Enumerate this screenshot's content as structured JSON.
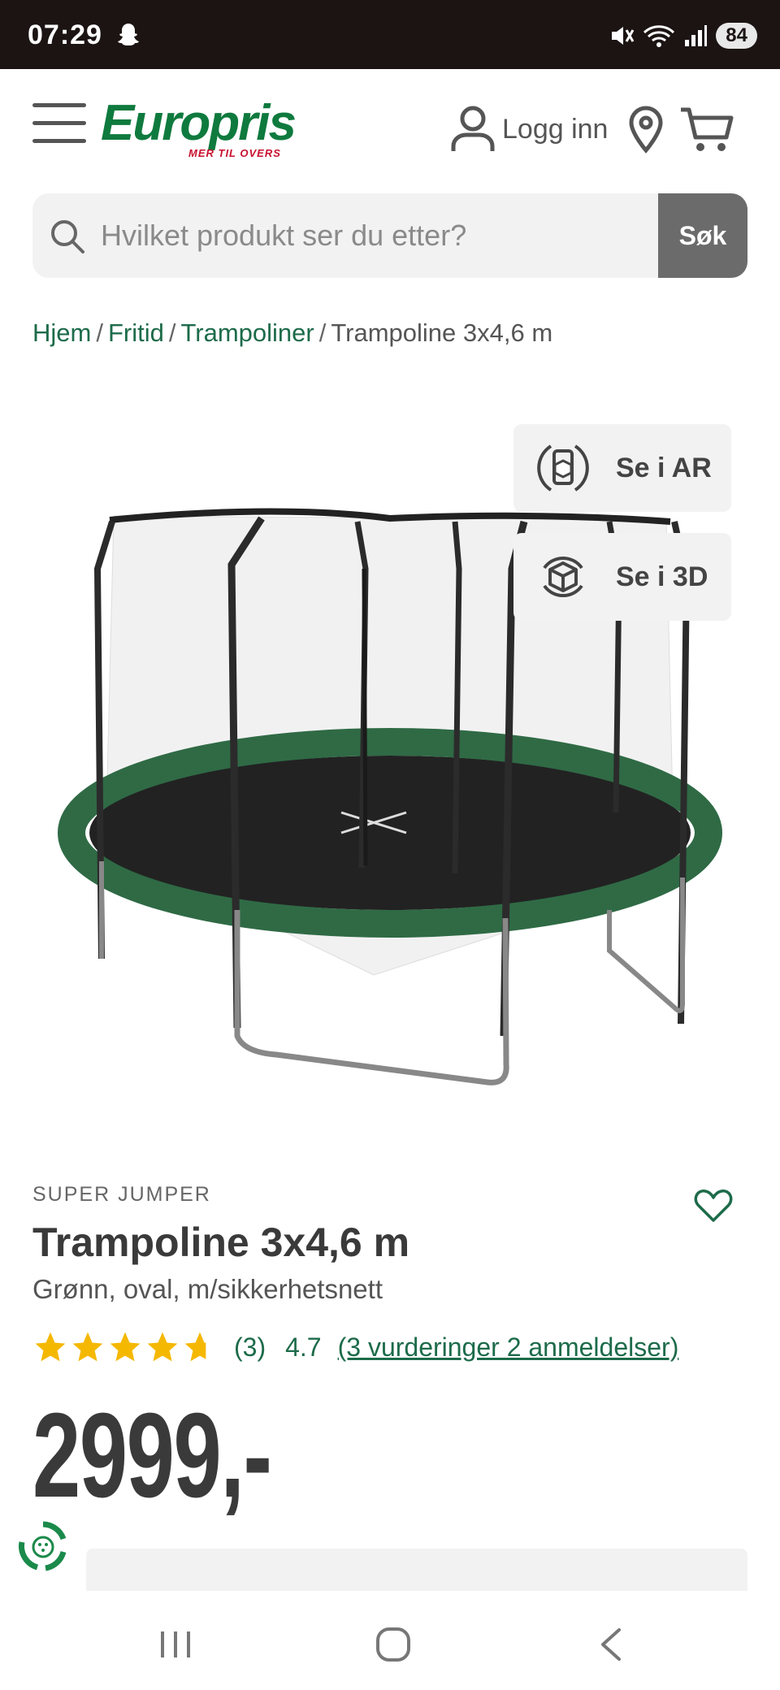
{
  "status": {
    "time": "07:29",
    "battery": "84"
  },
  "header": {
    "logo_text": "Europris",
    "logo_tagline": "MER TIL OVERS",
    "login_label": "Logg inn"
  },
  "search": {
    "placeholder": "Hvilket produkt ser du etter?",
    "button_label": "Søk"
  },
  "breadcrumb": {
    "items": [
      "Hjem",
      "Fritid",
      "Trampoliner"
    ],
    "separator": "/",
    "current": "Trampoline 3x4,6 m"
  },
  "media": {
    "ar_label": "Se i AR",
    "threed_label": "Se i 3D"
  },
  "product": {
    "brand": "SUPER JUMPER",
    "title": "Trampoline 3x4,6 m",
    "subtitle": "Grønn, oval, m/sikkerhetsnett",
    "rating_count": "(3)",
    "rating_value": "4.7",
    "rating_stars": 4.7,
    "rating_link": "(3 vurderinger 2 anmeldelser)",
    "price": "2999,-"
  },
  "colors": {
    "brand_green": "#0f7a3e",
    "link_green": "#1d6b4a",
    "star_yellow": "#f5b800",
    "status_bar": "#1b1413",
    "trampoline_pad": "#2f6a45"
  }
}
